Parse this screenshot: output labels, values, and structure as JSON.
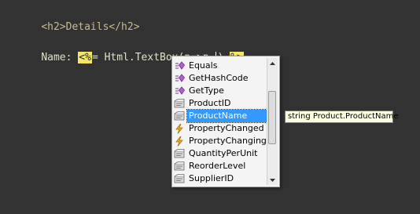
{
  "code": {
    "line1": "<h2>Details</h2>",
    "line2": {
      "prefix": "Name: ",
      "open_delim": "<%",
      "expr_a": "= Html.TextBox(",
      "expr_b": "p=>p.",
      "expr_c": ")",
      "close_delim": "%>"
    }
  },
  "completion": {
    "items": [
      {
        "label": "Equals",
        "icon": "method-icon"
      },
      {
        "label": "GetHashCode",
        "icon": "method-icon"
      },
      {
        "label": "GetType",
        "icon": "method-icon"
      },
      {
        "label": "ProductID",
        "icon": "property-icon"
      },
      {
        "label": "ProductName",
        "icon": "property-icon",
        "selected": true
      },
      {
        "label": "PropertyChanged",
        "icon": "event-icon"
      },
      {
        "label": "PropertyChanging",
        "icon": "event-icon"
      },
      {
        "label": "QuantityPerUnit",
        "icon": "property-icon"
      },
      {
        "label": "ReorderLevel",
        "icon": "property-icon"
      },
      {
        "label": "SupplierID",
        "icon": "property-icon"
      }
    ],
    "tooltip": "string Product.ProductName"
  },
  "colors": {
    "background": "#323232",
    "selection": "#3399ff",
    "delimiter_highlight": "#f5e66a",
    "tooltip_bg": "#ffffe1",
    "error_squiggle": "#e03030"
  }
}
